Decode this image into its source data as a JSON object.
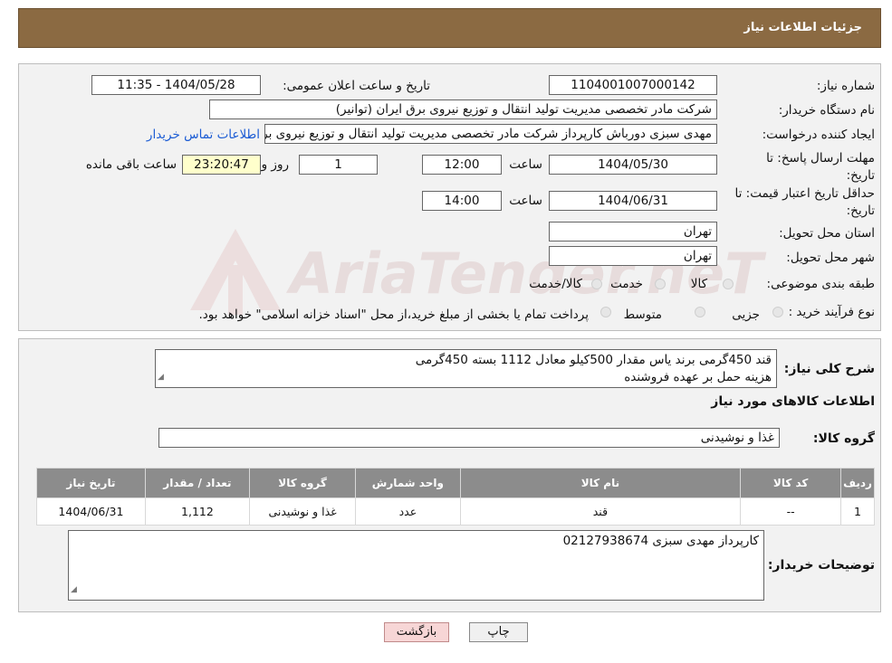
{
  "header": {
    "title": "جزئیات اطلاعات نیاز"
  },
  "watermark": {
    "text": "AriaTender.neT"
  },
  "form": {
    "need_number_label": "شماره نیاز:",
    "need_number": "1104001007000142",
    "announce_label": "تاریخ و ساعت اعلان عمومی:",
    "announce_value": "1404/05/28 - 11:35",
    "buyer_label": "نام دستگاه خریدار:",
    "buyer_value": "شرکت مادر تخصصی مدیریت تولید  انتقال و توزیع نیروی برق ایران (توانیر)",
    "requester_label": "ایجاد کننده درخواست:",
    "requester_value": "مهدی سبزی دورباش کارپرداز شرکت مادر تخصصی مدیریت تولید  انتقال و توزیع نیروی برق ایران (توانیر)",
    "contact_link": "اطلاعات تماس خریدار",
    "deadline_label": "مهلت ارسال پاسخ: تا تاریخ:",
    "deadline_date": "1404/05/30",
    "time_label": "ساعت",
    "deadline_time": "12:00",
    "days_value": "1",
    "days_label": "روز و",
    "remaining_value": "23:20:47",
    "remaining_label": "ساعت باقی مانده",
    "validity_label": "حداقل تاریخ اعتبار قیمت: تا تاریخ:",
    "validity_date": "1404/06/31",
    "validity_time": "14:00",
    "province_label": "استان محل تحویل:",
    "province_value": "تهران",
    "city_label": "شهر محل تحویل:",
    "city_value": "تهران",
    "category_label": "طبقه بندی موضوعی:",
    "category_options": [
      "کالا",
      "خدمت",
      "کالا/خدمت"
    ],
    "process_label": "نوع فرآیند خرید :",
    "process_options": [
      "جزیی",
      "متوسط"
    ],
    "process_note": "پرداخت تمام یا بخشی از مبلغ خرید،از محل \"اسناد خزانه اسلامی\" خواهد بود."
  },
  "summary": {
    "label": "شرح کلی نیاز:",
    "lines": [
      "قند 450گرمی برند یاس مقدار 500کیلو معادل 1112 بسته 450گرمی",
      "هزینه حمل بر عهده فروشنده"
    ]
  },
  "goods": {
    "title": "اطلاعات کالاهای مورد نیاز",
    "group_label": "گروه کالا:",
    "group_value": "غذا و نوشیدنی",
    "columns": [
      "ردیف",
      "کد کالا",
      "نام کالا",
      "واحد شمارش",
      "گروه کالا",
      "تعداد / مقدار",
      "تاریخ نیاز"
    ],
    "rows": [
      [
        "1",
        "--",
        "قند",
        "عدد",
        "غذا و نوشیدنی",
        "1,112",
        "1404/06/31"
      ]
    ]
  },
  "buyer_notes": {
    "label": "توضیحات خریدار:",
    "text": "کارپرداز مهدی سبزی 02127938674"
  },
  "buttons": {
    "print": "چاپ",
    "back": "بازگشت"
  }
}
